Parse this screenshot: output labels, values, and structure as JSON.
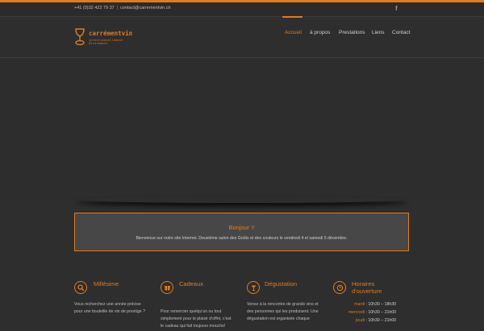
{
  "topbar": {
    "phone": "+41 (0)32 422 79 37",
    "email": "contact@carrementvin.ch",
    "social_icon": "facebook-icon"
  },
  "logo": {
    "name": "carrémentvin",
    "tagline": "intentionnellement Atrocement",
    "icon": "wine-glass-icon"
  },
  "nav": {
    "items": [
      "Accueil",
      "à propos",
      "Prestations",
      "Liens",
      "Contact"
    ],
    "active_index": 0
  },
  "welcome": {
    "title": "Bonjour !!",
    "text": "Bienvenue sur notre site Internet. Deuxième salon des Goûts et des couleurs le vendredi 4 et samedi 5 décembre."
  },
  "features": [
    {
      "title": "Millésime",
      "icon": "search-icon",
      "text": [
        "Vous recherchez une année précise",
        "pour une bouteille de vin de prestige ?"
      ]
    },
    {
      "title": "Cadeaux",
      "icon": "gift-icon",
      "text": [
        "Pour remercier quelqu'un ou tout",
        "simplement pour le plaisir d'offrir, c'est",
        "le cadeau qui fait toujours mouche!"
      ]
    },
    {
      "title": "Dégustation",
      "icon": "glass-icon",
      "text": [
        "Venez à la rencontre de grands vins et",
        "des personnes qui les produisent. Une",
        "dégustation est organisée chaque"
      ]
    },
    {
      "title": "Horaires d'ouverture",
      "title_line1": "Horaires",
      "title_line2": "d'ouverture",
      "icon": "clock-icon"
    }
  ],
  "hours": [
    {
      "day": "mardi",
      "time": "10h30 – 18h30"
    },
    {
      "day": "mercredi",
      "time": "10h30 – 21h00"
    },
    {
      "day": "jeudi",
      "time": "10h30 – 21h00"
    }
  ],
  "colors": {
    "accent": "#e07b1f",
    "background": "#2e2e2e",
    "box": "#474747"
  }
}
